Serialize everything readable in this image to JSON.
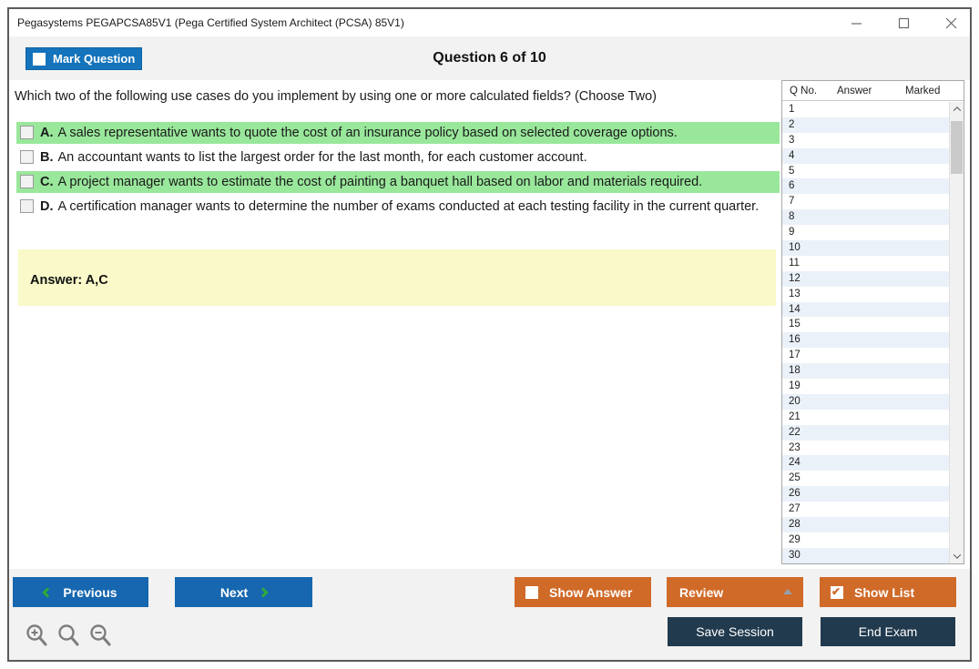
{
  "window": {
    "title": "Pegasystems PEGAPCSA85V1 (Pega Certified System Architect (PCSA) 85V1)"
  },
  "header": {
    "mark_question_label": "Mark Question",
    "question_counter": "Question 6 of 10"
  },
  "question": {
    "text": "Which two of the following use cases do you implement by using one or more calculated fields? (Choose Two)",
    "options": [
      {
        "letter": "A.",
        "text": "A sales representative wants to quote the cost of an insurance policy based on selected coverage options.",
        "highlighted": true
      },
      {
        "letter": "B.",
        "text": "An accountant wants to list the largest order for the last month, for each customer account.",
        "highlighted": false
      },
      {
        "letter": "C.",
        "text": "A project manager wants to estimate the cost of painting a banquet hall based on labor and materials required.",
        "highlighted": true
      },
      {
        "letter": "D.",
        "text": "A certification manager wants to determine the number of exams conducted at each testing facility in the current quarter.",
        "highlighted": false
      }
    ],
    "answer": "Answer: A,C"
  },
  "question_list": {
    "headers": [
      "Q No.",
      "Answer",
      "Marked"
    ],
    "numbers": [
      "1",
      "2",
      "3",
      "4",
      "5",
      "6",
      "7",
      "8",
      "9",
      "10",
      "11",
      "12",
      "13",
      "14",
      "15",
      "16",
      "17",
      "18",
      "19",
      "20",
      "21",
      "22",
      "23",
      "24",
      "25",
      "26",
      "27",
      "28",
      "29",
      "30"
    ]
  },
  "footer": {
    "previous": "Previous",
    "next": "Next",
    "show_answer": "Show Answer",
    "review": "Review",
    "show_list": "Show List",
    "save_session": "Save Session",
    "end_exam": "End Exam"
  },
  "colors": {
    "accent_blue": "#1473bb",
    "nav_blue": "#1667af",
    "orange": "#d06a28",
    "navy": "#213a4e",
    "highlight_green": "#99e79b",
    "answer_yellow": "#f9f9c9",
    "row_stripe": "#eaf1f8"
  }
}
